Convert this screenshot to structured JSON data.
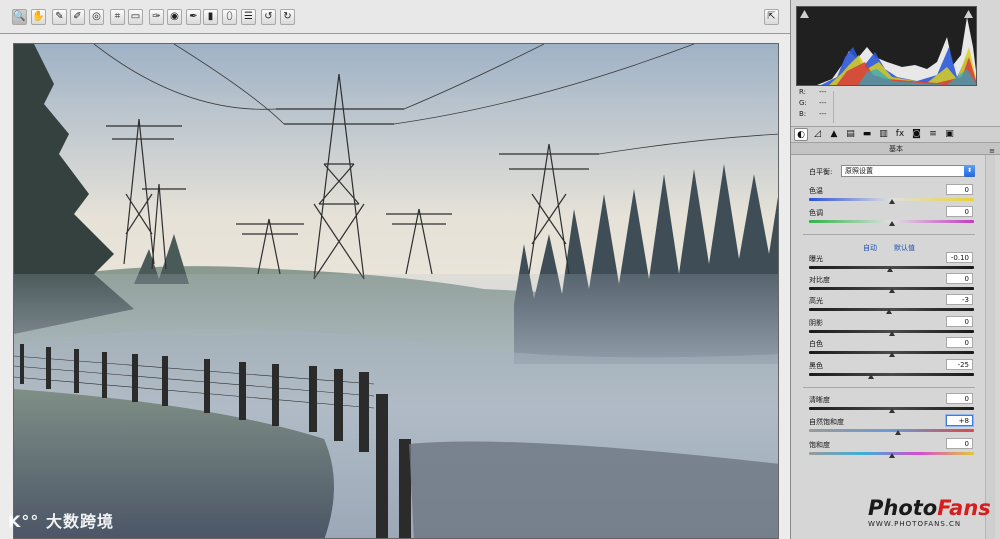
{
  "toolbar": {
    "tools": [
      {
        "name": "zoom-tool",
        "icon": "magnifier-icon",
        "glyph": "🔍"
      },
      {
        "name": "hand-tool",
        "icon": "hand-icon",
        "glyph": "✋"
      },
      {
        "name": "white-balance-tool",
        "icon": "eyedropper-icon",
        "glyph": "✎"
      },
      {
        "name": "color-sampler-tool",
        "icon": "eyedropper-plus-icon",
        "glyph": "✐"
      },
      {
        "name": "targeted-adjustment-tool",
        "icon": "target-icon",
        "glyph": "◎"
      },
      {
        "name": "crop-tool",
        "icon": "crop-icon",
        "glyph": "⌗"
      },
      {
        "name": "straighten-tool",
        "icon": "ruler-icon",
        "glyph": "▭"
      },
      {
        "name": "spot-removal-tool",
        "icon": "brush-icon",
        "glyph": "✑"
      },
      {
        "name": "red-eye-tool",
        "icon": "eye-icon",
        "glyph": "◉"
      },
      {
        "name": "adjustment-brush-tool",
        "icon": "paintbrush-icon",
        "glyph": "✒"
      },
      {
        "name": "graduated-filter-tool",
        "icon": "gradient-icon",
        "glyph": "▮"
      },
      {
        "name": "radial-filter-tool",
        "icon": "ellipse-icon",
        "glyph": "⬯"
      },
      {
        "name": "preferences-tool",
        "icon": "list-icon",
        "glyph": "☰"
      },
      {
        "name": "rotate-left-tool",
        "icon": "rotate-ccw-icon",
        "glyph": "↺"
      },
      {
        "name": "rotate-right-tool",
        "icon": "rotate-cw-icon",
        "glyph": "↻"
      }
    ],
    "fullscreen_glyph": "⇱"
  },
  "histogram": {
    "rgb": [
      {
        "label": "R:",
        "value": "---"
      },
      {
        "label": "G:",
        "value": "---"
      },
      {
        "label": "B:",
        "value": "---"
      }
    ]
  },
  "tabs": [
    {
      "name": "basic",
      "glyph": "◐"
    },
    {
      "name": "tone-curve",
      "glyph": "◿"
    },
    {
      "name": "detail",
      "glyph": "▲"
    },
    {
      "name": "hsl",
      "glyph": "▤"
    },
    {
      "name": "split-toning",
      "glyph": "▬"
    },
    {
      "name": "lens-corrections",
      "glyph": "▥"
    },
    {
      "name": "effects",
      "glyph": "fx"
    },
    {
      "name": "camera-calibration",
      "glyph": "◙"
    },
    {
      "name": "presets",
      "glyph": "≡"
    },
    {
      "name": "snapshots",
      "glyph": "▣"
    }
  ],
  "basic": {
    "section_title": "基本",
    "menu_glyph": "≡",
    "white_balance_label": "白平衡:",
    "white_balance_value": "原照设置",
    "white_balance_arrow": "⬍",
    "auto_label": "自动",
    "default_label": "默认值",
    "sliders": [
      {
        "name": "temperature",
        "label": "色温",
        "value": "0",
        "pos": 0.5,
        "track": "temp"
      },
      {
        "name": "tint",
        "label": "色调",
        "value": "0",
        "pos": 0.5,
        "track": "tint"
      },
      {
        "name": "exposure",
        "label": "曝光",
        "value": "-0.10",
        "pos": 0.49,
        "track": "dark"
      },
      {
        "name": "contrast",
        "label": "对比度",
        "value": "0",
        "pos": 0.5,
        "track": "dark"
      },
      {
        "name": "highlights",
        "label": "高光",
        "value": "-3",
        "pos": 0.485,
        "track": "dark"
      },
      {
        "name": "shadows",
        "label": "阴影",
        "value": "0",
        "pos": 0.5,
        "track": "dark"
      },
      {
        "name": "whites",
        "label": "白色",
        "value": "0",
        "pos": 0.5,
        "track": "dark"
      },
      {
        "name": "blacks",
        "label": "黑色",
        "value": "-25",
        "pos": 0.375,
        "track": "dark"
      },
      {
        "name": "clarity",
        "label": "清晰度",
        "value": "0",
        "pos": 0.5,
        "track": "dark"
      },
      {
        "name": "vibrance",
        "label": "自然饱和度",
        "value": "+8",
        "pos": 0.54,
        "track": "vib",
        "focus": true
      },
      {
        "name": "saturation",
        "label": "饱和度",
        "value": "0",
        "pos": 0.5,
        "track": "sat"
      }
    ]
  },
  "watermarks": {
    "left": "大数跨境",
    "left_logo": "K°°",
    "right_brand_1": "Photo",
    "right_brand_2": "Fans",
    "right_url": "WWW.PHOTOFANS.CN"
  },
  "colors": {
    "panel_bg": "#d6d6d6",
    "accent_blue": "#2466d8",
    "link_blue": "#1f4fa8",
    "brand_red": "#d61e1e"
  }
}
